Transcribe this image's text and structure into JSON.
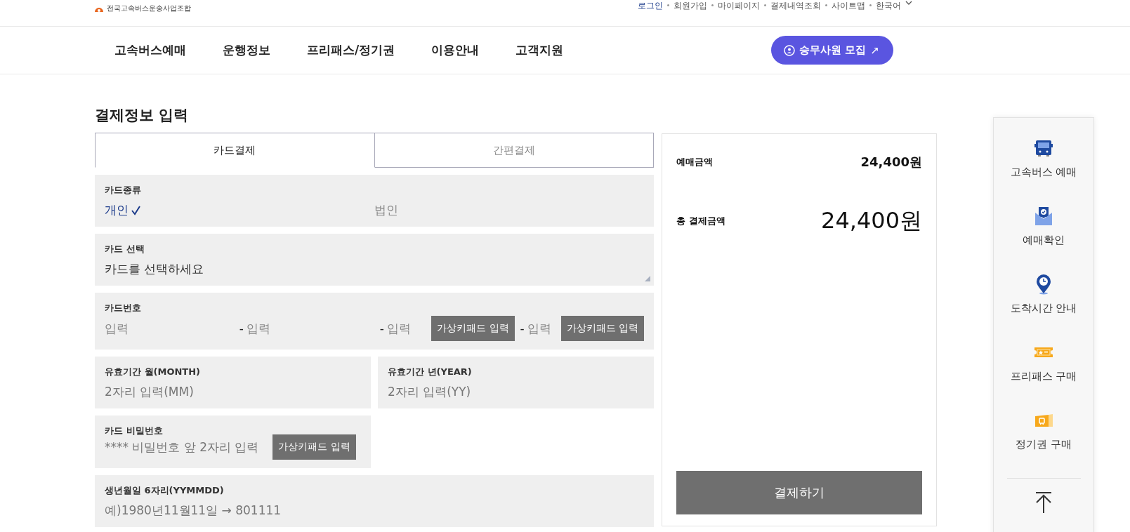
{
  "header": {
    "logo_subtitle": "전국고속버스운송사업조합",
    "top_links": [
      {
        "label": "로그인",
        "emphasized": true
      },
      {
        "label": "회원가입",
        "emphasized": false
      },
      {
        "label": "마이페이지",
        "emphasized": false
      },
      {
        "label": "결제내역조회",
        "emphasized": false
      },
      {
        "label": "사이트맵",
        "emphasized": false
      },
      {
        "label": "한국어",
        "emphasized": false
      }
    ],
    "nav": [
      "고속버스예매",
      "운행정보",
      "프리패스/정기권",
      "이용안내",
      "고객지원"
    ],
    "recruit_button": {
      "label": "승무사원 모집",
      "arrow": "↗"
    }
  },
  "page_title": "결제정보 입력",
  "tabs": [
    {
      "label": "카드결제",
      "selected": true
    },
    {
      "label": "간편결제",
      "selected": false
    }
  ],
  "rows": [
    [
      {
        "kind": "radio",
        "label": "카드종류",
        "options": [
          {
            "label": "개인",
            "selected": true
          },
          {
            "label": "법인",
            "selected": false
          }
        ]
      }
    ],
    [
      {
        "kind": "select",
        "label": "카드 선택",
        "value": "카드를 선택하세요"
      }
    ],
    [
      {
        "kind": "card_number",
        "label": "카드번호",
        "segments": [
          {
            "placeholder": "입력"
          },
          {
            "separator": "-",
            "placeholder": "입력"
          },
          {
            "separator": "-",
            "placeholder": "입력",
            "keypad": "가상키패드 입력"
          },
          {
            "separator": "-",
            "placeholder": "입력",
            "keypad": "가상키패드 입력"
          }
        ]
      }
    ],
    [
      {
        "kind": "text",
        "label": "유효기간 월(MONTH)",
        "placeholder": "2자리 입력(MM)"
      },
      {
        "kind": "text",
        "label": "유효기간 년(YEAR)",
        "placeholder": "2자리 입력(YY)"
      }
    ],
    [
      {
        "kind": "text",
        "label": "카드 비밀번호",
        "placeholder": "**** 비밀번호 앞 2자리 입력",
        "keypad": "가상키패드 입력"
      }
    ],
    [
      {
        "kind": "text",
        "label": "생년월일 6자리(YYMMDD)",
        "placeholder": "예)1980년11월11일 → 801111"
      }
    ]
  ],
  "summary": {
    "items": [
      {
        "kind": "subtotal",
        "label": "예매금액",
        "amount": "24,400원"
      },
      {
        "kind": "total",
        "label": "총 결제금액",
        "amount": "24,400원"
      }
    ],
    "pay_button": "결제하기"
  },
  "quick_menu": [
    {
      "kind": "bus",
      "label": "고속버스 예매"
    },
    {
      "kind": "envelope",
      "label": "예매확인"
    },
    {
      "kind": "pin",
      "label": "도착시간 안내"
    },
    {
      "kind": "ticket",
      "label": "프리패스 구매"
    },
    {
      "kind": "pass",
      "label": "정기권 구매"
    }
  ]
}
